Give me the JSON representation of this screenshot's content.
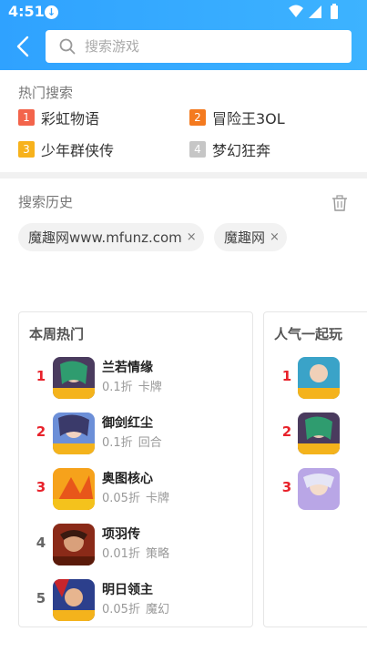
{
  "status": {
    "time": "4:51",
    "download_icon": "download-arrow-icon"
  },
  "search": {
    "placeholder": "搜索游戏"
  },
  "hot_search": {
    "title": "热门搜索",
    "items": [
      {
        "rank": "1",
        "name": "彩虹物语",
        "color": "#f3644b"
      },
      {
        "rank": "2",
        "name": "冒险王3OL",
        "color": "#f47a1f"
      },
      {
        "rank": "3",
        "name": "少年群侠传",
        "color": "#f7b21c"
      },
      {
        "rank": "4",
        "name": "梦幻狂奔",
        "color": "#c6c6c6"
      }
    ]
  },
  "history": {
    "title": "搜索历史",
    "chips": [
      "魔趣网www.mfunz.com",
      "魔趣网"
    ],
    "close_glyph": "×"
  },
  "weekly_hot": {
    "title": "本周热门",
    "items": [
      {
        "rank": "1",
        "name": "兰若情缘",
        "discount": "0.1折",
        "genre": "卡牌",
        "rank_color": "#e8222b"
      },
      {
        "rank": "2",
        "name": "御剑红尘",
        "discount": "0.1折",
        "genre": "回合",
        "rank_color": "#e8222b"
      },
      {
        "rank": "3",
        "name": "奥图核心",
        "discount": "0.05折",
        "genre": "卡牌",
        "rank_color": "#e8222b"
      },
      {
        "rank": "4",
        "name": "项羽传",
        "discount": "0.01折",
        "genre": "策略",
        "rank_color": "#666666"
      },
      {
        "rank": "5",
        "name": "明日领主",
        "discount": "0.05折",
        "genre": "魔幻",
        "rank_color": "#666666"
      }
    ]
  },
  "popular_together": {
    "title": "人气一起玩",
    "items": [
      {
        "rank": "1",
        "rank_color": "#e8222b"
      },
      {
        "rank": "2",
        "rank_color": "#e8222b"
      },
      {
        "rank": "3",
        "rank_color": "#e8222b"
      }
    ]
  }
}
